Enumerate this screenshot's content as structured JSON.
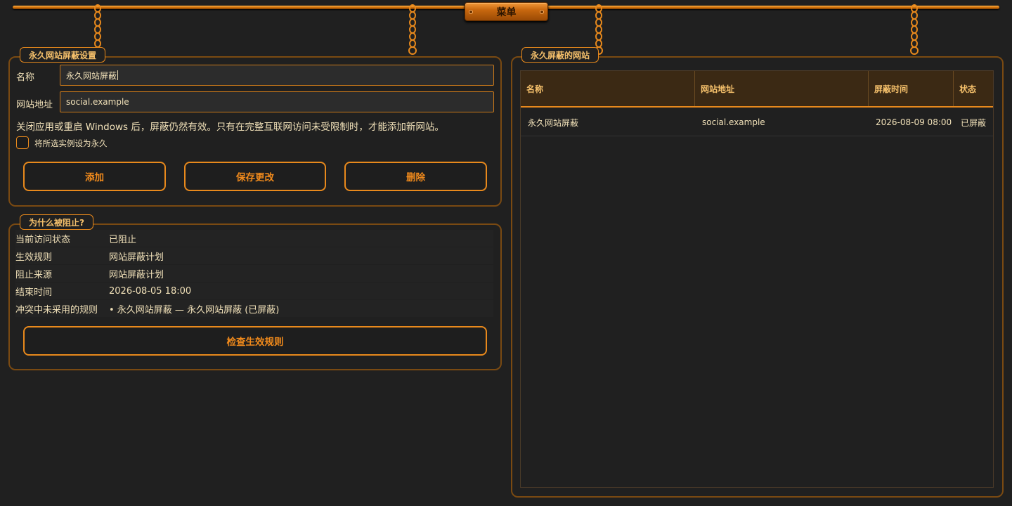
{
  "menu": {
    "label": "菜单"
  },
  "settings": {
    "title": "永久网站屏蔽设置",
    "name_label": "名称",
    "name_value": "永久网站屏蔽",
    "url_label": "网站地址",
    "url_value": "social.example",
    "note": "关闭应用或重启 Windows 后，屏蔽仍然有效。只有在完整互联网访问未受限制时，才能添加新网站。",
    "checkbox_label": "将所选实例设为永久",
    "checkbox_checked": false,
    "add_label": "添加",
    "save_label": "保存更改",
    "delete_label": "删除"
  },
  "why": {
    "title": "为什么被阻止?",
    "rows": [
      {
        "key": "当前访问状态",
        "value": "已阻止"
      },
      {
        "key": "生效规则",
        "value": "网站屏蔽计划"
      },
      {
        "key": "阻止来源",
        "value": "网站屏蔽计划"
      },
      {
        "key": "结束时间",
        "value": "2026-08-05 18:00"
      },
      {
        "key": "冲突中未采用的规则",
        "value": "• 永久网站屏蔽 — 永久网站屏蔽 (已屏蔽)"
      }
    ],
    "check_label": "检查生效规则"
  },
  "blocked": {
    "title": "永久屏蔽的网站",
    "columns": [
      "名称",
      "网站地址",
      "屏蔽时间",
      "状态"
    ],
    "rows": [
      {
        "name": "永久网站屏蔽",
        "url": "social.example",
        "time": "2026-08-09 08:00",
        "status": "已屏蔽"
      }
    ]
  },
  "colors": {
    "accent": "#e8891c",
    "background": "#202020",
    "text": "#f0e0b8",
    "header_bg": "#3b2914"
  }
}
